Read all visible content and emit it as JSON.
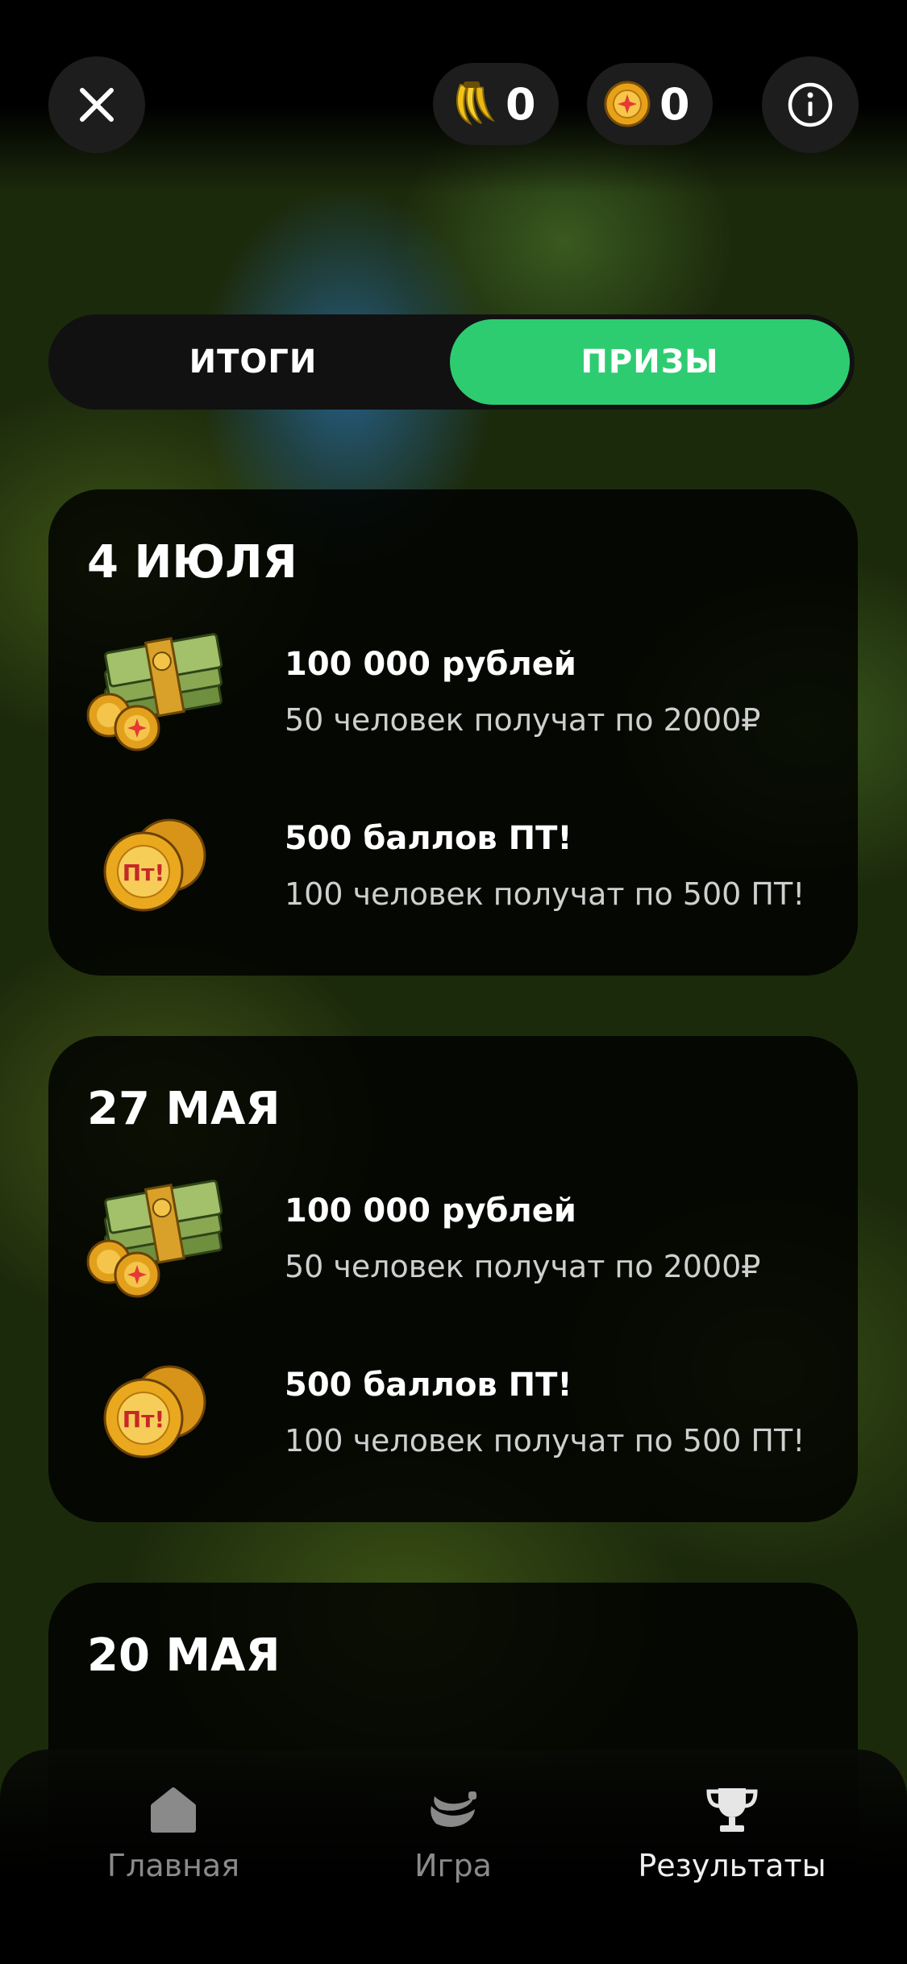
{
  "header": {
    "close_icon": "close-icon",
    "bananas": {
      "icon": "bananas-icon",
      "count": "0"
    },
    "points": {
      "icon": "pt-chip-icon",
      "count": "0"
    },
    "info_icon": "info-icon"
  },
  "tabs": [
    {
      "label": "ИТОГИ",
      "active": false
    },
    {
      "label": "ПРИЗЫ",
      "active": true
    }
  ],
  "accent_color": "#2ecc71",
  "cards": [
    {
      "date": "4 ИЮЛЯ",
      "prizes": [
        {
          "icon": "money-stack-icon",
          "title": "100 000 рублей",
          "desc": "50 человек получат по 2000₽"
        },
        {
          "icon": "pt-chips-icon",
          "title": "500 баллов ПТ!",
          "desc": "100 человек получат по 500 ПТ!"
        }
      ]
    },
    {
      "date": "27 МАЯ",
      "prizes": [
        {
          "icon": "money-stack-icon",
          "title": "100 000 рублей",
          "desc": "50 человек получат по 2000₽"
        },
        {
          "icon": "pt-chips-icon",
          "title": "500 баллов ПТ!",
          "desc": "100 человек получат по 500 ПТ!"
        }
      ]
    },
    {
      "date": "20 МАЯ",
      "prizes": []
    }
  ],
  "nav": [
    {
      "label": "Главная",
      "icon": "home-icon",
      "active": false
    },
    {
      "label": "Игра",
      "icon": "banana-icon",
      "active": false
    },
    {
      "label": "Результаты",
      "icon": "trophy-icon",
      "active": true
    }
  ]
}
